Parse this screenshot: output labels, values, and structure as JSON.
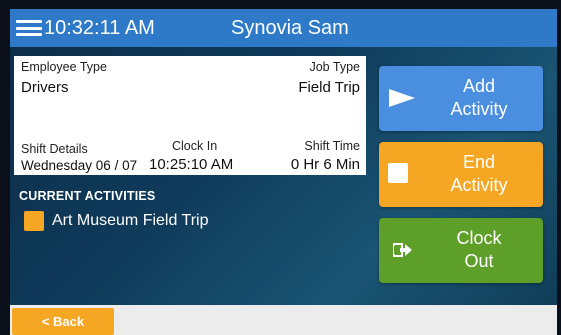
{
  "header": {
    "time": "10:32:11 AM",
    "user_name": "Synovia Sam"
  },
  "info": {
    "employee_type_label": "Employee Type",
    "employee_type_value": "Drivers",
    "job_type_label": "Job Type",
    "job_type_value": "Field Trip",
    "shift_details_label": "Shift Details",
    "shift_details_value": "Wednesday 06 / 07",
    "clock_in_label": "Clock In",
    "clock_in_value": "10:25:10 AM",
    "shift_time_label": "Shift Time",
    "shift_time_value": "0 Hr 6 Min"
  },
  "activities": {
    "title": "CURRENT ACTIVITIES",
    "items": [
      {
        "label": "Art Museum Field Trip",
        "color": "#f5a623"
      }
    ]
  },
  "actions": {
    "add": {
      "line1": "Add",
      "line2": "Activity",
      "icon": "play-icon",
      "color": "#4a8fdf"
    },
    "end": {
      "line1": "End",
      "line2": "Activity",
      "icon": "stop-icon",
      "color": "#f5a623"
    },
    "clock_out": {
      "line1": "Clock",
      "line2": "Out",
      "icon": "exit-icon",
      "color": "#5e9f2a"
    }
  },
  "footer": {
    "back_label": "< Back"
  },
  "colors": {
    "header_bar": "#2e7ac9",
    "accent_orange": "#f5a623"
  }
}
